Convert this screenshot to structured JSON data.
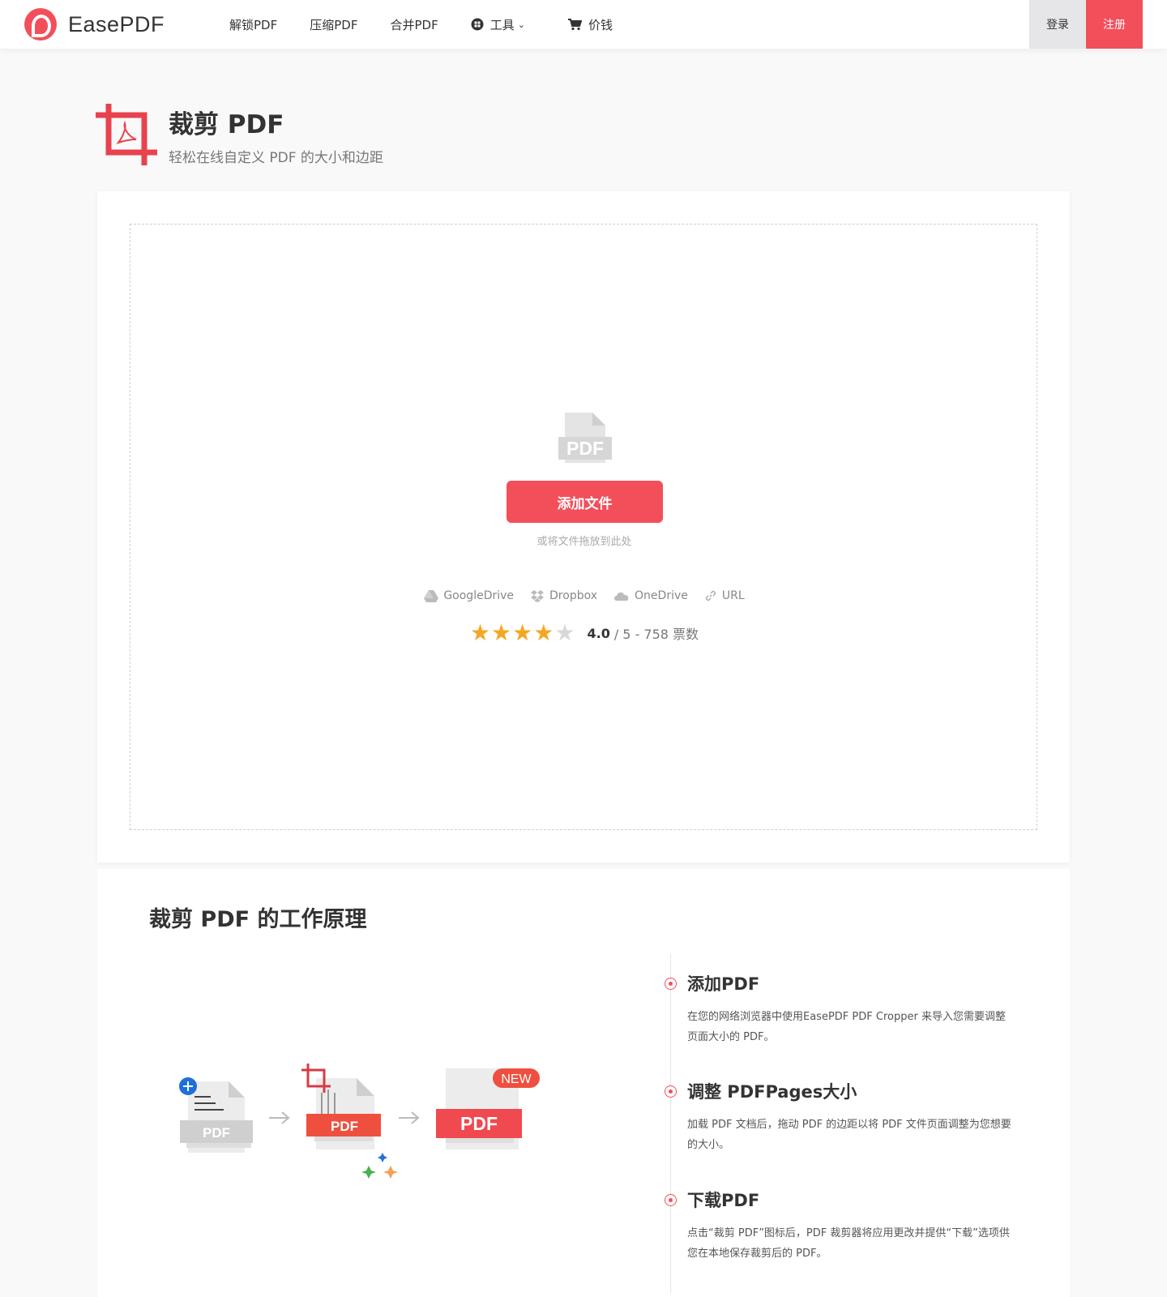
{
  "brand": {
    "name": "EasePDF",
    "accent": "#f24f5a"
  },
  "nav": {
    "items": [
      {
        "label": "解锁PDF"
      },
      {
        "label": "压缩PDF"
      },
      {
        "label": "合并PDF"
      },
      {
        "label": "工具",
        "icon": "grid-icon"
      },
      {
        "label": "价钱",
        "icon": "cart-icon"
      }
    ],
    "login_label": "登录",
    "signup_label": "注册"
  },
  "page": {
    "title": "裁剪 PDF",
    "subtitle": "轻松在线自定义 PDF 的大小和边距"
  },
  "upload": {
    "placeholder_label": "PDF",
    "button_label": "添加文件",
    "drop_hint": "或将文件拖放到此处",
    "sources": [
      {
        "label": "GoogleDrive",
        "icon": "google-drive-icon"
      },
      {
        "label": "Dropbox",
        "icon": "dropbox-icon"
      },
      {
        "label": "OneDrive",
        "icon": "onedrive-icon"
      },
      {
        "label": "URL",
        "icon": "link-icon"
      }
    ],
    "rating": {
      "score": "4.0",
      "suffix": "/ 5 - 758 票数",
      "value": 4,
      "max": 5
    }
  },
  "how_it_works": {
    "title": "裁剪 PDF 的工作原理",
    "illustration": {
      "pdf_label": "PDF",
      "new_badge": "NEW"
    },
    "steps": [
      {
        "title": "添加PDF",
        "desc": "在您的网络浏览器中使用EasePDF PDF Cropper 来导入您需要调整页面大小的 PDF。"
      },
      {
        "title": "调整 PDFPages大小",
        "desc": "加载 PDF 文档后，拖动 PDF 的边距以将 PDF 文件页面调整为您想要的大小。"
      },
      {
        "title": "下载PDF",
        "desc": "点击“裁剪 PDF”图标后，PDF 裁剪器将应用更改并提供“下载”选项供您在本地保存裁剪后的 PDF。"
      }
    ]
  }
}
